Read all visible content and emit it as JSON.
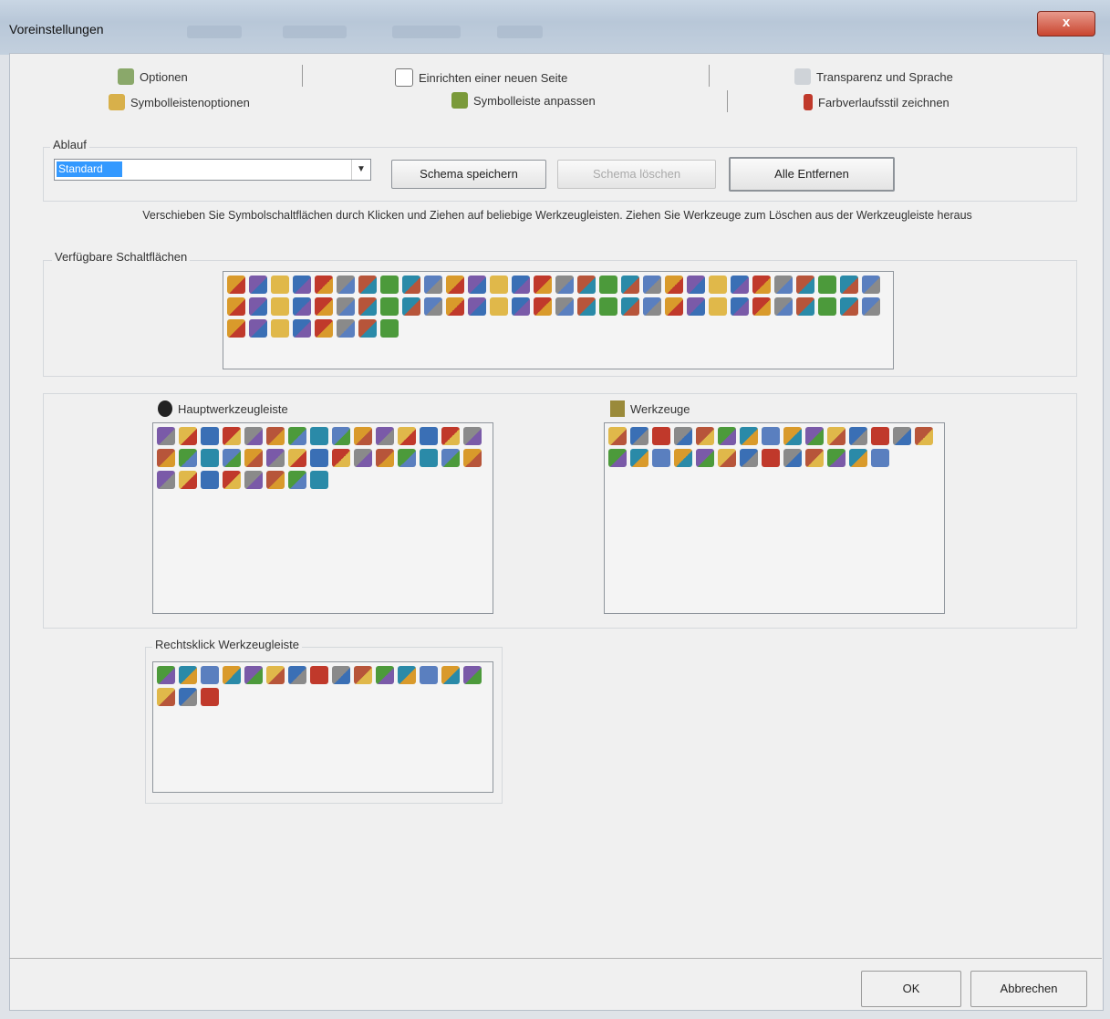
{
  "window": {
    "title": "Voreinstellungen",
    "close_label": "x"
  },
  "tabs": [
    {
      "label": "Optionen",
      "icon": "options-icon"
    },
    {
      "label": "Einrichten einer neuen Seite",
      "icon": "page-icon"
    },
    {
      "label": "Transparenz und Sprache",
      "icon": "transparency-icon"
    },
    {
      "label": "Symbolleistenoptionen",
      "icon": "toolbar-options-icon"
    },
    {
      "label": "Symbolleiste anpassen",
      "icon": "customize-toolbar-icon"
    },
    {
      "label": "Farbverlaufsstil zeichnen",
      "icon": "gradient-style-icon"
    }
  ],
  "ablauf": {
    "label": "Ablauf",
    "selected": "Standard",
    "save_scheme": "Schema speichern",
    "delete_scheme": "Schema löschen",
    "remove_all": "Alle Entfernen"
  },
  "hint": "Verschieben Sie Symbolschaltflächen durch Klicken und Ziehen auf beliebige Werkzeugleisten. Ziehen Sie Werkzeuge zum Löschen aus der Werkzeugleiste heraus",
  "available": {
    "label": "Verfügbare Schaltflächen",
    "count": 68
  },
  "main_toolbar": {
    "label": "Hauptwerkzeugleiste",
    "count": 38
  },
  "tools": {
    "label": "Werkzeuge",
    "count": 28
  },
  "rightclick": {
    "label": "Rechtsklick Werkzeugleiste",
    "count": 18
  },
  "footer": {
    "ok": "OK",
    "cancel": "Abbrechen"
  },
  "colors": {
    "icon_palette": [
      "#3a6fb5",
      "#d99a2b",
      "#4c9a3b",
      "#c0392b",
      "#7a5aa8",
      "#2a8aa8",
      "#8a8a8a",
      "#e0b84a",
      "#5a7fbf",
      "#b7553a"
    ]
  }
}
